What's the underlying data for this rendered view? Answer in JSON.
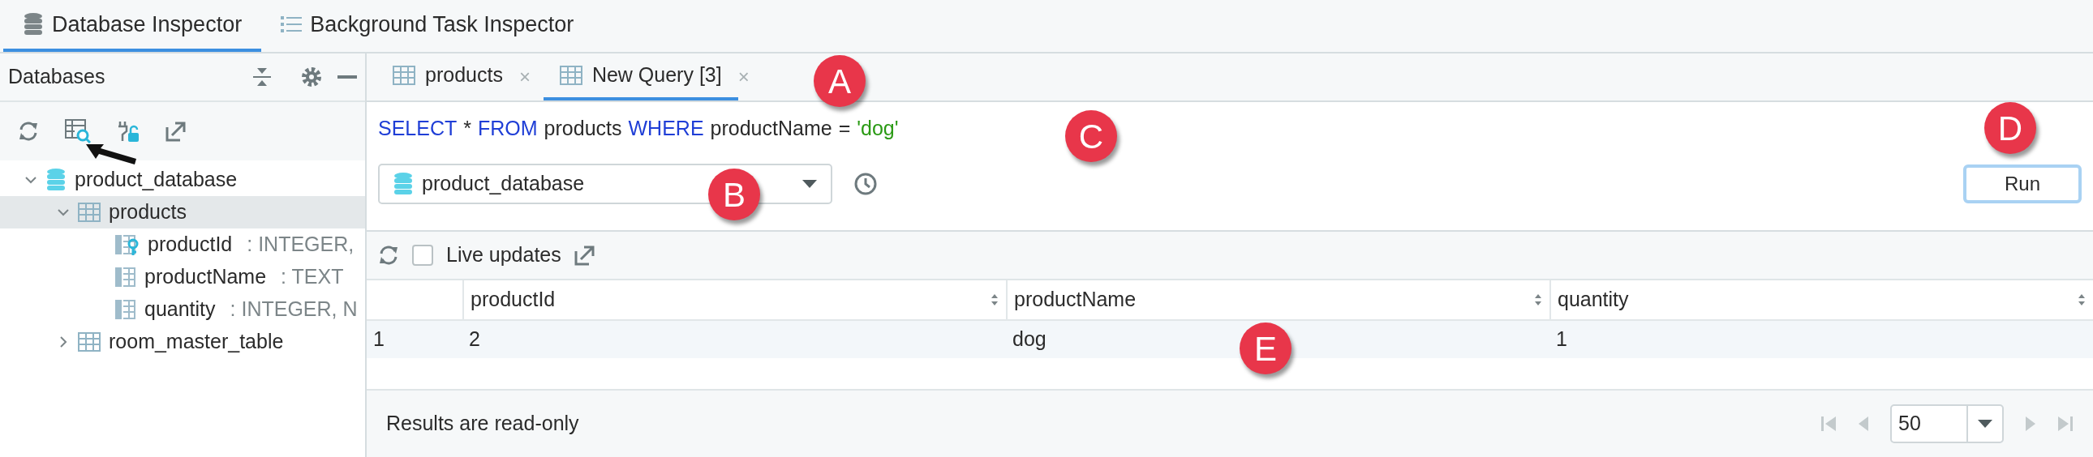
{
  "tool_tabs": [
    {
      "label": "Database Inspector",
      "selected": true
    },
    {
      "label": "Background Task Inspector",
      "selected": false
    }
  ],
  "sidebar": {
    "title": "Databases",
    "tree": [
      {
        "label": "product_database",
        "kind": "database",
        "expanded": true,
        "selected": false,
        "children": [
          {
            "label": "products",
            "kind": "table",
            "expanded": true,
            "selected": true,
            "children": [
              {
                "label": "productId",
                "detail": ":  INTEGER,",
                "kind": "key_column",
                "selected": false
              },
              {
                "label": "productName",
                "detail": ":  TEXT",
                "kind": "column",
                "selected": false
              },
              {
                "label": "quantity",
                "detail": ":  INTEGER, N",
                "kind": "column",
                "selected": false
              }
            ]
          },
          {
            "label": "room_master_table",
            "kind": "table",
            "expanded": false,
            "selected": false
          }
        ]
      }
    ]
  },
  "query_tabs": [
    {
      "label": "products",
      "close": "×",
      "selected": false
    },
    {
      "label": "New Query [3]",
      "close": "×",
      "selected": true
    }
  ],
  "query": [
    {
      "text": "SELECT",
      "kind": "keyword"
    },
    {
      "text": "*",
      "kind": "operator"
    },
    {
      "text": "FROM",
      "kind": "keyword"
    },
    {
      "text": "products",
      "kind": "identifier"
    },
    {
      "text": "WHERE",
      "kind": "keyword"
    },
    {
      "text": "productName",
      "kind": "identifier"
    },
    {
      "text": "=",
      "kind": "operator"
    },
    {
      "text": "'dog'",
      "kind": "string"
    }
  ],
  "database_select": {
    "value": "product_database"
  },
  "run_button": "Run",
  "live_updates": {
    "label": "Live updates",
    "checked": false
  },
  "table": {
    "columns": [
      "productId",
      "productName",
      "quantity"
    ],
    "rows": [
      {
        "index": "1",
        "cells": [
          "2",
          "dog",
          "1"
        ]
      }
    ]
  },
  "footer": {
    "status": "Results are read-only",
    "page_size": "50"
  },
  "callouts": [
    {
      "label": "A"
    },
    {
      "label": "B"
    },
    {
      "label": "C"
    },
    {
      "label": "D"
    },
    {
      "label": "E"
    }
  ]
}
